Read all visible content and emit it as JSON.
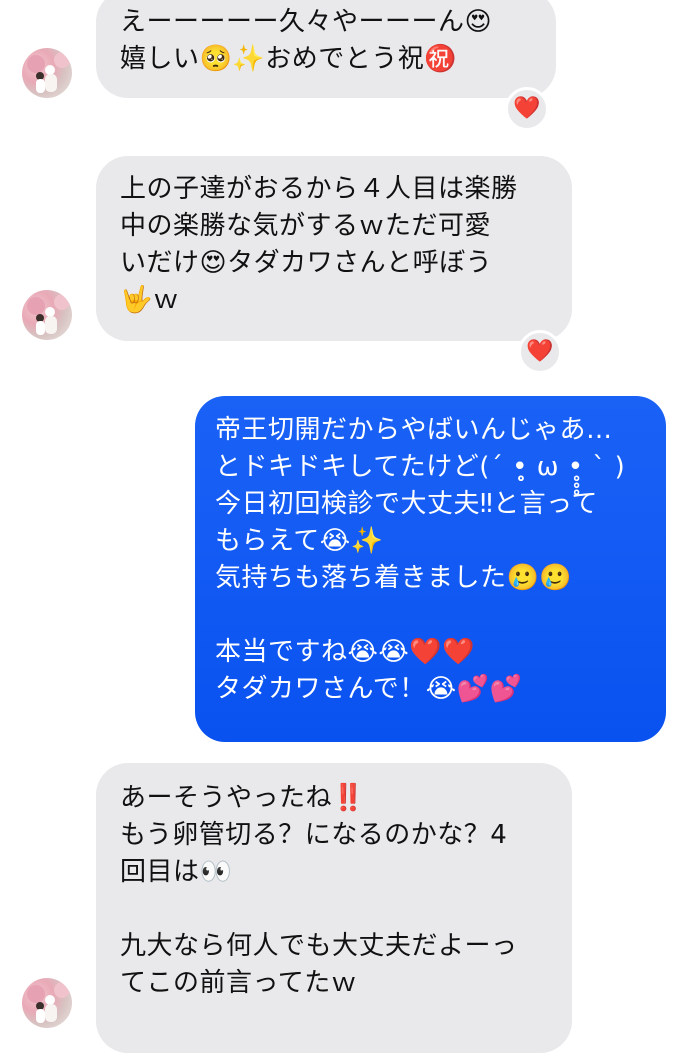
{
  "conversation": {
    "messages": [
      {
        "direction": "incoming",
        "text": "えーーーーー久々やーーーん😍\n嬉しい🥺✨おめでとう祝㊗️",
        "reaction": "❤️"
      },
      {
        "direction": "incoming",
        "text": "上の子達がおるから４人目は楽勝\n中の楽勝な気がするｗただ可愛\nいだけ😍タダカワさんと呼ぼう\n🤟ｗ",
        "reaction": "❤️"
      },
      {
        "direction": "outgoing",
        "text": "帝王切開だからやばいんじゃあ…\nとドキドキしてたけど(´ •̥̥̥ ω •̥̥̥ ` )\n今日初回検診で大丈夫‼︎と言って\nもらえて😭✨\n気持ちも落ち着きました🥲🥲\n\n本当ですね😭😭❤️❤️\nタダカワさんで！😭💕💕"
      },
      {
        "direction": "incoming",
        "text": "あーそうやったね‼️\nもう卵管切る？になるのかな？4\n回目は👀\n\n九大なら何人でも大丈夫だよーっ\nてこの前言ってたｗ"
      }
    ]
  }
}
